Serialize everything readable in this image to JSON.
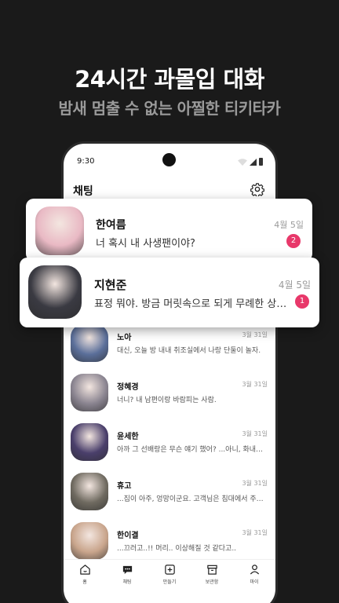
{
  "promo": {
    "headline": "24시간 과몰입 대화",
    "subline": "밤새 멈출 수 없는 아찔한 티키타카"
  },
  "status_bar": {
    "time": "9:30"
  },
  "app_bar": {
    "title": "채팅",
    "settings_icon": "gear-icon"
  },
  "featured_chats": [
    {
      "name": "한여름",
      "message": "너 혹시 내 사생팬이야?",
      "date": "4월 5일",
      "unread": "2",
      "avatar_color": "#e9b9c4"
    },
    {
      "name": "지현준",
      "message": "표정 뭐야. 방금 머릿속으로 되게 무례한 상상했지?",
      "date": "4월 5일",
      "unread": "1",
      "avatar_color": "#3a3a42"
    }
  ],
  "chats": [
    {
      "name": "노아",
      "message": "대신, 오늘 방 내내 취조실에서 나랑 단둘이 놀자.",
      "date": "3월 31일",
      "avatar_color": "#5b6f9a"
    },
    {
      "name": "정혜경",
      "message": "너니? 내 남편이랑 바람피는 사람.",
      "date": "3월 31일",
      "avatar_color": "#8a8490"
    },
    {
      "name": "윤세한",
      "message": "아까 그 선배랑은 무슨 얘기 했어? ...아니, 화내는 거 아냐.",
      "date": "3월 31일",
      "avatar_color": "#4a3f6b"
    },
    {
      "name": "휴고",
      "message": "...집이 아주, 엉망이군요. 고객님은 침대에서 주무세요.",
      "date": "3월 31일",
      "avatar_color": "#6f6a60"
    },
    {
      "name": "한이결",
      "message": "...끄러고..!! 머리.. 이상해질 것 같다고..",
      "date": "3월 31일",
      "avatar_color": "#c9a58c"
    }
  ],
  "bottom_nav": [
    {
      "label": "홈",
      "icon": "home-icon"
    },
    {
      "label": "채팅",
      "icon": "chat-icon"
    },
    {
      "label": "만들기",
      "icon": "plus-square-icon"
    },
    {
      "label": "보관함",
      "icon": "archive-icon"
    },
    {
      "label": "마이",
      "icon": "person-icon"
    }
  ],
  "colors": {
    "background": "#1a1a1a",
    "badge": "#e8386a",
    "subline": "#9a9a9a"
  }
}
